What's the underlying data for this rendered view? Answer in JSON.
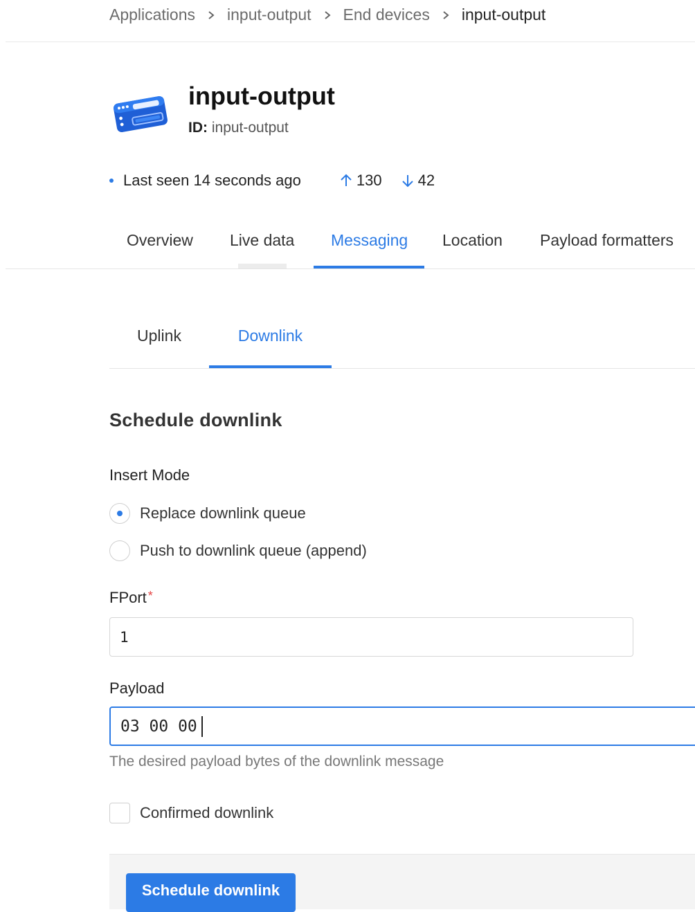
{
  "breadcrumb": {
    "items": [
      "Applications",
      "input-output",
      "End devices"
    ],
    "current": "input-output"
  },
  "device": {
    "name": "input-output",
    "id_label": "ID:",
    "id_value": "input-output",
    "icon": "lorawan-device-icon"
  },
  "status": {
    "last_seen": "Last seen 14 seconds ago",
    "uplink_count": "130",
    "downlink_count": "42"
  },
  "tabs": [
    "Overview",
    "Live data",
    "Messaging",
    "Location",
    "Payload formatters"
  ],
  "active_tab": "Messaging",
  "sub_tabs": [
    "Uplink",
    "Downlink"
  ],
  "active_sub_tab": "Downlink",
  "form": {
    "section_title": "Schedule downlink",
    "insert_mode_label": "Insert Mode",
    "insert_mode_options": [
      "Replace downlink queue",
      "Push to downlink queue (append)"
    ],
    "insert_mode_selected": "Replace downlink queue",
    "fport_label": "FPort",
    "fport_value": "1",
    "payload_label": "Payload",
    "payload_value": "03 00 00",
    "payload_hint": "The desired payload bytes of the downlink message",
    "confirmed_label": "Confirmed downlink",
    "confirmed_checked": false,
    "submit_label": "Schedule downlink"
  },
  "colors": {
    "accent": "#2c7be5",
    "required": "#e54545"
  }
}
